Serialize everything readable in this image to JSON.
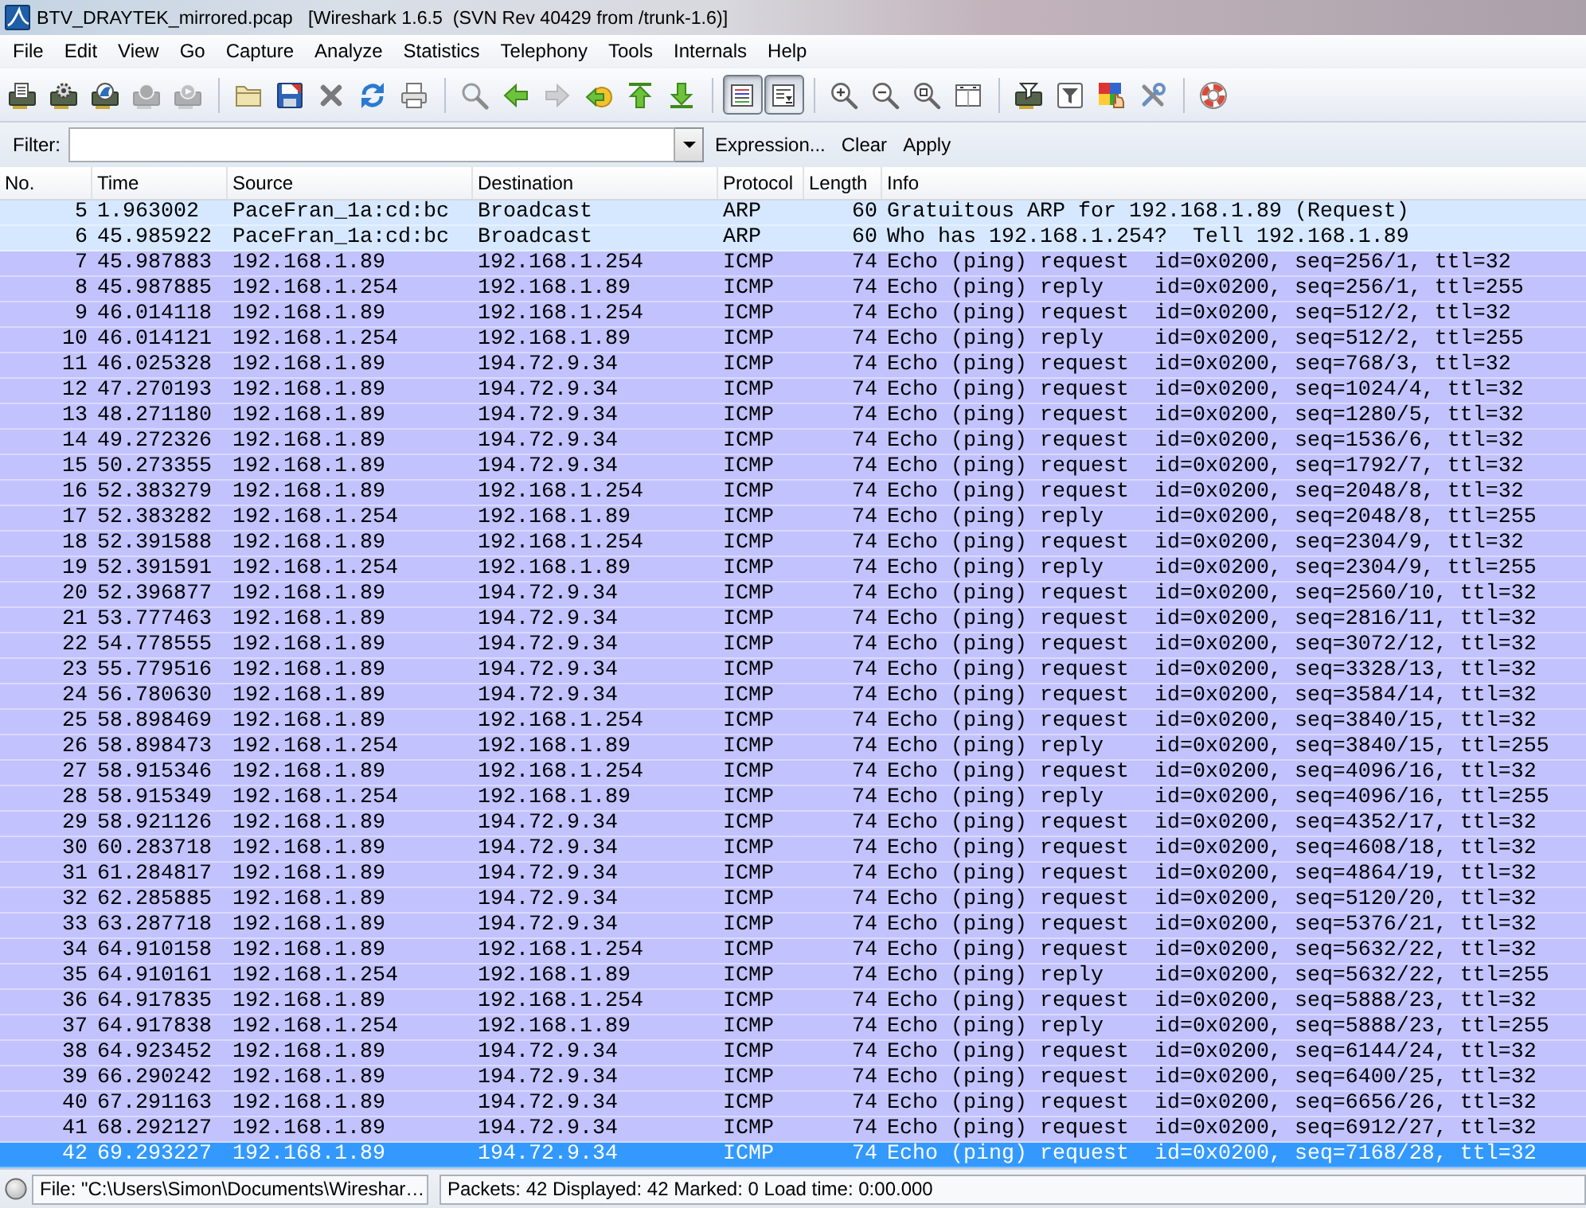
{
  "window": {
    "title": "BTV_DRAYTEK_mirrored.pcap   [Wireshark 1.6.5  (SVN Rev 40429 from /trunk-1.6)]"
  },
  "menu": [
    "File",
    "Edit",
    "View",
    "Go",
    "Capture",
    "Analyze",
    "Statistics",
    "Telephony",
    "Tools",
    "Internals",
    "Help"
  ],
  "toolbar": {
    "groups": [
      {
        "items": [
          {
            "kind": "button",
            "disabled": false
          },
          {
            "kind": "button",
            "disabled": false
          },
          {
            "kind": "button",
            "disabled": false
          },
          {
            "kind": "button",
            "disabled": true
          },
          {
            "kind": "button",
            "disabled": true
          }
        ]
      },
      {
        "items": [
          {
            "kind": "button",
            "disabled": false
          },
          {
            "kind": "button",
            "disabled": false
          },
          {
            "kind": "button",
            "disabled": false
          },
          {
            "kind": "button",
            "disabled": false
          },
          {
            "kind": "button",
            "disabled": false
          }
        ]
      },
      {
        "items": [
          {
            "kind": "button",
            "disabled": false
          },
          {
            "kind": "button",
            "disabled": false
          },
          {
            "kind": "button",
            "disabled": true
          },
          {
            "kind": "button",
            "disabled": false
          },
          {
            "kind": "button",
            "disabled": false
          },
          {
            "kind": "button",
            "disabled": false
          }
        ]
      },
      {
        "items": [
          {
            "kind": "toggle",
            "disabled": false,
            "on": true
          },
          {
            "kind": "toggle",
            "disabled": false,
            "on": true
          }
        ]
      },
      {
        "items": [
          {
            "kind": "button",
            "disabled": false
          },
          {
            "kind": "button",
            "disabled": false
          },
          {
            "kind": "button",
            "disabled": false
          },
          {
            "kind": "button",
            "disabled": false
          }
        ]
      },
      {
        "items": [
          {
            "kind": "button",
            "disabled": false
          },
          {
            "kind": "button",
            "disabled": false
          },
          {
            "kind": "button",
            "disabled": false
          },
          {
            "kind": "button",
            "disabled": false
          }
        ]
      },
      {
        "items": [
          {
            "kind": "button",
            "disabled": false
          }
        ]
      }
    ]
  },
  "filter": {
    "label": "Filter:",
    "buttons": [
      "Expression...",
      "Clear",
      "Apply"
    ]
  },
  "packet_list": {
    "columns": [
      "No.",
      "Time",
      "Source",
      "Destination",
      "Protocol",
      "Length",
      "Info"
    ],
    "rows": [
      {
        "cells": [
          "5",
          "1.963002",
          "PaceFran_1a:cd:bc",
          "Broadcast",
          "ARP",
          "60",
          "Gratuitous ARP for 192.168.1.89 (Request)"
        ],
        "color": "#d6e8ff",
        "selected": false
      },
      {
        "cells": [
          "6",
          "45.985922",
          "PaceFran_1a:cd:bc",
          "Broadcast",
          "ARP",
          "60",
          "Who has 192.168.1.254?  Tell 192.168.1.89"
        ],
        "color": "#d6e8ff",
        "selected": false
      },
      {
        "cells": [
          "7",
          "45.987883",
          "192.168.1.89",
          "192.168.1.254",
          "ICMP",
          "74",
          "Echo (ping) request  id=0x0200, seq=256/1, ttl=32"
        ],
        "color": "#c2c2ff",
        "selected": false
      },
      {
        "cells": [
          "8",
          "45.987885",
          "192.168.1.254",
          "192.168.1.89",
          "ICMP",
          "74",
          "Echo (ping) reply    id=0x0200, seq=256/1, ttl=255"
        ],
        "color": "#c2c2ff",
        "selected": false
      },
      {
        "cells": [
          "9",
          "46.014118",
          "192.168.1.89",
          "192.168.1.254",
          "ICMP",
          "74",
          "Echo (ping) request  id=0x0200, seq=512/2, ttl=32"
        ],
        "color": "#c2c2ff",
        "selected": false
      },
      {
        "cells": [
          "10",
          "46.014121",
          "192.168.1.254",
          "192.168.1.89",
          "ICMP",
          "74",
          "Echo (ping) reply    id=0x0200, seq=512/2, ttl=255"
        ],
        "color": "#c2c2ff",
        "selected": false
      },
      {
        "cells": [
          "11",
          "46.025328",
          "192.168.1.89",
          "194.72.9.34",
          "ICMP",
          "74",
          "Echo (ping) request  id=0x0200, seq=768/3, ttl=32"
        ],
        "color": "#c2c2ff",
        "selected": false
      },
      {
        "cells": [
          "12",
          "47.270193",
          "192.168.1.89",
          "194.72.9.34",
          "ICMP",
          "74",
          "Echo (ping) request  id=0x0200, seq=1024/4, ttl=32"
        ],
        "color": "#c2c2ff",
        "selected": false
      },
      {
        "cells": [
          "13",
          "48.271180",
          "192.168.1.89",
          "194.72.9.34",
          "ICMP",
          "74",
          "Echo (ping) request  id=0x0200, seq=1280/5, ttl=32"
        ],
        "color": "#c2c2ff",
        "selected": false
      },
      {
        "cells": [
          "14",
          "49.272326",
          "192.168.1.89",
          "194.72.9.34",
          "ICMP",
          "74",
          "Echo (ping) request  id=0x0200, seq=1536/6, ttl=32"
        ],
        "color": "#c2c2ff",
        "selected": false
      },
      {
        "cells": [
          "15",
          "50.273355",
          "192.168.1.89",
          "194.72.9.34",
          "ICMP",
          "74",
          "Echo (ping) request  id=0x0200, seq=1792/7, ttl=32"
        ],
        "color": "#c2c2ff",
        "selected": false
      },
      {
        "cells": [
          "16",
          "52.383279",
          "192.168.1.89",
          "192.168.1.254",
          "ICMP",
          "74",
          "Echo (ping) request  id=0x0200, seq=2048/8, ttl=32"
        ],
        "color": "#c2c2ff",
        "selected": false
      },
      {
        "cells": [
          "17",
          "52.383282",
          "192.168.1.254",
          "192.168.1.89",
          "ICMP",
          "74",
          "Echo (ping) reply    id=0x0200, seq=2048/8, ttl=255"
        ],
        "color": "#c2c2ff",
        "selected": false
      },
      {
        "cells": [
          "18",
          "52.391588",
          "192.168.1.89",
          "192.168.1.254",
          "ICMP",
          "74",
          "Echo (ping) request  id=0x0200, seq=2304/9, ttl=32"
        ],
        "color": "#c2c2ff",
        "selected": false
      },
      {
        "cells": [
          "19",
          "52.391591",
          "192.168.1.254",
          "192.168.1.89",
          "ICMP",
          "74",
          "Echo (ping) reply    id=0x0200, seq=2304/9, ttl=255"
        ],
        "color": "#c2c2ff",
        "selected": false
      },
      {
        "cells": [
          "20",
          "52.396877",
          "192.168.1.89",
          "194.72.9.34",
          "ICMP",
          "74",
          "Echo (ping) request  id=0x0200, seq=2560/10, ttl=32"
        ],
        "color": "#c2c2ff",
        "selected": false
      },
      {
        "cells": [
          "21",
          "53.777463",
          "192.168.1.89",
          "194.72.9.34",
          "ICMP",
          "74",
          "Echo (ping) request  id=0x0200, seq=2816/11, ttl=32"
        ],
        "color": "#c2c2ff",
        "selected": false
      },
      {
        "cells": [
          "22",
          "54.778555",
          "192.168.1.89",
          "194.72.9.34",
          "ICMP",
          "74",
          "Echo (ping) request  id=0x0200, seq=3072/12, ttl=32"
        ],
        "color": "#c2c2ff",
        "selected": false
      },
      {
        "cells": [
          "23",
          "55.779516",
          "192.168.1.89",
          "194.72.9.34",
          "ICMP",
          "74",
          "Echo (ping) request  id=0x0200, seq=3328/13, ttl=32"
        ],
        "color": "#c2c2ff",
        "selected": false
      },
      {
        "cells": [
          "24",
          "56.780630",
          "192.168.1.89",
          "194.72.9.34",
          "ICMP",
          "74",
          "Echo (ping) request  id=0x0200, seq=3584/14, ttl=32"
        ],
        "color": "#c2c2ff",
        "selected": false
      },
      {
        "cells": [
          "25",
          "58.898469",
          "192.168.1.89",
          "192.168.1.254",
          "ICMP",
          "74",
          "Echo (ping) request  id=0x0200, seq=3840/15, ttl=32"
        ],
        "color": "#c2c2ff",
        "selected": false
      },
      {
        "cells": [
          "26",
          "58.898473",
          "192.168.1.254",
          "192.168.1.89",
          "ICMP",
          "74",
          "Echo (ping) reply    id=0x0200, seq=3840/15, ttl=255"
        ],
        "color": "#c2c2ff",
        "selected": false
      },
      {
        "cells": [
          "27",
          "58.915346",
          "192.168.1.89",
          "192.168.1.254",
          "ICMP",
          "74",
          "Echo (ping) request  id=0x0200, seq=4096/16, ttl=32"
        ],
        "color": "#c2c2ff",
        "selected": false
      },
      {
        "cells": [
          "28",
          "58.915349",
          "192.168.1.254",
          "192.168.1.89",
          "ICMP",
          "74",
          "Echo (ping) reply    id=0x0200, seq=4096/16, ttl=255"
        ],
        "color": "#c2c2ff",
        "selected": false
      },
      {
        "cells": [
          "29",
          "58.921126",
          "192.168.1.89",
          "194.72.9.34",
          "ICMP",
          "74",
          "Echo (ping) request  id=0x0200, seq=4352/17, ttl=32"
        ],
        "color": "#c2c2ff",
        "selected": false
      },
      {
        "cells": [
          "30",
          "60.283718",
          "192.168.1.89",
          "194.72.9.34",
          "ICMP",
          "74",
          "Echo (ping) request  id=0x0200, seq=4608/18, ttl=32"
        ],
        "color": "#c2c2ff",
        "selected": false
      },
      {
        "cells": [
          "31",
          "61.284817",
          "192.168.1.89",
          "194.72.9.34",
          "ICMP",
          "74",
          "Echo (ping) request  id=0x0200, seq=4864/19, ttl=32"
        ],
        "color": "#c2c2ff",
        "selected": false
      },
      {
        "cells": [
          "32",
          "62.285885",
          "192.168.1.89",
          "194.72.9.34",
          "ICMP",
          "74",
          "Echo (ping) request  id=0x0200, seq=5120/20, ttl=32"
        ],
        "color": "#c2c2ff",
        "selected": false
      },
      {
        "cells": [
          "33",
          "63.287718",
          "192.168.1.89",
          "194.72.9.34",
          "ICMP",
          "74",
          "Echo (ping) request  id=0x0200, seq=5376/21, ttl=32"
        ],
        "color": "#c2c2ff",
        "selected": false
      },
      {
        "cells": [
          "34",
          "64.910158",
          "192.168.1.89",
          "192.168.1.254",
          "ICMP",
          "74",
          "Echo (ping) request  id=0x0200, seq=5632/22, ttl=32"
        ],
        "color": "#c2c2ff",
        "selected": false
      },
      {
        "cells": [
          "35",
          "64.910161",
          "192.168.1.254",
          "192.168.1.89",
          "ICMP",
          "74",
          "Echo (ping) reply    id=0x0200, seq=5632/22, ttl=255"
        ],
        "color": "#c2c2ff",
        "selected": false
      },
      {
        "cells": [
          "36",
          "64.917835",
          "192.168.1.89",
          "192.168.1.254",
          "ICMP",
          "74",
          "Echo (ping) request  id=0x0200, seq=5888/23, ttl=32"
        ],
        "color": "#c2c2ff",
        "selected": false
      },
      {
        "cells": [
          "37",
          "64.917838",
          "192.168.1.254",
          "192.168.1.89",
          "ICMP",
          "74",
          "Echo (ping) reply    id=0x0200, seq=5888/23, ttl=255"
        ],
        "color": "#c2c2ff",
        "selected": false
      },
      {
        "cells": [
          "38",
          "64.923452",
          "192.168.1.89",
          "194.72.9.34",
          "ICMP",
          "74",
          "Echo (ping) request  id=0x0200, seq=6144/24, ttl=32"
        ],
        "color": "#c2c2ff",
        "selected": false
      },
      {
        "cells": [
          "39",
          "66.290242",
          "192.168.1.89",
          "194.72.9.34",
          "ICMP",
          "74",
          "Echo (ping) request  id=0x0200, seq=6400/25, ttl=32"
        ],
        "color": "#c2c2ff",
        "selected": false
      },
      {
        "cells": [
          "40",
          "67.291163",
          "192.168.1.89",
          "194.72.9.34",
          "ICMP",
          "74",
          "Echo (ping) request  id=0x0200, seq=6656/26, ttl=32"
        ],
        "color": "#c2c2ff",
        "selected": false
      },
      {
        "cells": [
          "41",
          "68.292127",
          "192.168.1.89",
          "194.72.9.34",
          "ICMP",
          "74",
          "Echo (ping) request  id=0x0200, seq=6912/27, ttl=32"
        ],
        "color": "#c2c2ff",
        "selected": false
      },
      {
        "cells": [
          "42",
          "69.293227",
          "192.168.1.89",
          "194.72.9.34",
          "ICMP",
          "74",
          "Echo (ping) request  id=0x0200, seq=7168/28, ttl=32"
        ],
        "selected": true
      }
    ]
  },
  "status_bar": {
    "file": "File: \"C:\\Users\\Simon\\Documents\\Wireshar…",
    "summary": "Packets: 42 Displayed: 42 Marked: 0 Load time: 0:00.000"
  }
}
